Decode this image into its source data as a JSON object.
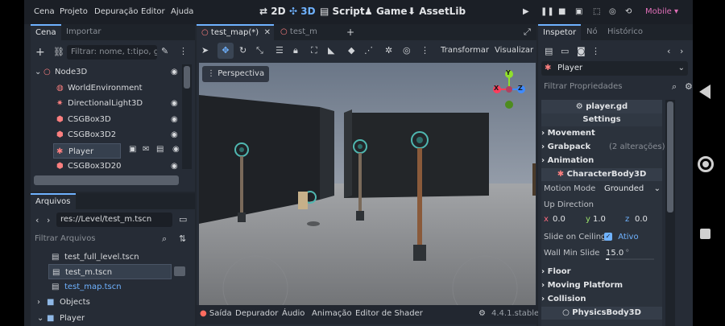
{
  "menu": [
    "Cena",
    "Projeto",
    "Depuração",
    "Editor",
    "Ajuda"
  ],
  "modes": {
    "m2d": "2D",
    "m3d": "3D",
    "script": "Script",
    "game": "Game",
    "assetlib": "AssetLib"
  },
  "renderer": "Mobile",
  "scene_panel": {
    "tabs": [
      "Cena",
      "Importar"
    ],
    "filter_placeholder": "Filtrar: nome, t:tipo, g",
    "tree": [
      {
        "label": "Node3D"
      },
      {
        "label": "WorldEnvironment"
      },
      {
        "label": "DirectionalLight3D"
      },
      {
        "label": "CSGBox3D"
      },
      {
        "label": "CSGBox3D2"
      },
      {
        "label": "Player"
      },
      {
        "label": "CSGBox3D20"
      }
    ]
  },
  "files_panel": {
    "tab": "Arquivos",
    "path": "res://Level/test_m.tscn",
    "filter_placeholder": "Filtrar Arquivos",
    "items": [
      {
        "label": "test_full_level.tscn"
      },
      {
        "label": "test_m.tscn"
      },
      {
        "label": "test_map.tscn"
      },
      {
        "label": "Objects"
      },
      {
        "label": "Player"
      }
    ]
  },
  "viewport": {
    "tabs": [
      "test_map(*)",
      "test_m"
    ],
    "transform_label": "Transformar",
    "view_label": "Visualizar",
    "perspective_label": "Perspectiva",
    "gizmo": {
      "y": "Y",
      "x": "X",
      "z": "Z"
    },
    "bottom": [
      "Saída",
      "Depurador",
      "Áudio",
      "Animação",
      "Editor de Shader"
    ],
    "version": "4.4.1.stable"
  },
  "inspector": {
    "tabs": [
      "Inspetor",
      "Nó",
      "Histórico"
    ],
    "node_name": "Player",
    "filter_placeholder": "Filtrar Propriedades",
    "script_name": "player.gd",
    "settings_label": "Settings",
    "sections": [
      {
        "label": "Movement",
        "note": ""
      },
      {
        "label": "Grabpack",
        "note": "(2 alterações)"
      },
      {
        "label": "Animation",
        "note": ""
      }
    ],
    "class_header": "CharacterBody3D",
    "motion_mode_label": "Motion Mode",
    "motion_mode_value": "Grounded",
    "up_direction_label": "Up Direction",
    "up": {
      "x_label": "x",
      "x": "0.0",
      "y_label": "y",
      "y": "1.0",
      "z_label": "z",
      "z": "0.0"
    },
    "slide_ceiling_label": "Slide on Ceiling",
    "slide_ceiling_value": "Ativo",
    "wall_min_slide_label": "Wall Min Slide",
    "wall_min_slide_value": "15.0",
    "wall_min_slide_unit": "°",
    "lower_sections": [
      "Floor",
      "Moving Platform",
      "Collision"
    ],
    "physics_header": "PhysicsBody3D"
  },
  "colors": {
    "accent": "#6fb2ff",
    "node_red": "#fc7f7f",
    "renderer": "#e06fb8"
  }
}
